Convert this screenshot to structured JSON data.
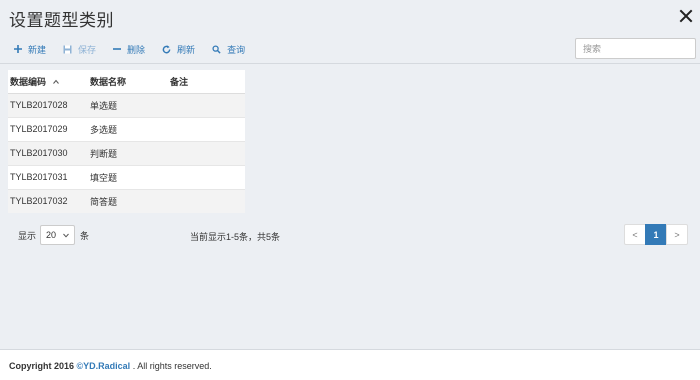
{
  "header": {
    "title": "设置题型类别"
  },
  "toolbar": {
    "new_label": "新建",
    "save_label": "保存",
    "delete_label": "删除",
    "refresh_label": "刷新",
    "query_label": "查询",
    "search_placeholder": "搜索"
  },
  "table": {
    "columns": [
      "数据编码",
      "数据名称",
      "备注"
    ],
    "rows": [
      {
        "code": "TYLB2017028",
        "name": "单选题",
        "remark": ""
      },
      {
        "code": "TYLB2017029",
        "name": "多选题",
        "remark": ""
      },
      {
        "code": "TYLB2017030",
        "name": "判断题",
        "remark": ""
      },
      {
        "code": "TYLB2017031",
        "name": "填空题",
        "remark": ""
      },
      {
        "code": "TYLB2017032",
        "name": "简答题",
        "remark": ""
      }
    ]
  },
  "pager": {
    "show_label": "显示",
    "page_size": "20",
    "unit_label": "条",
    "info": "当前显示1-5条，共5条",
    "prev": "<",
    "current_page": "1",
    "next": ">"
  },
  "footer": {
    "copyright_prefix": "Copyright 2016 ",
    "brand": "©YD.Radical",
    "suffix": " . All rights reserved."
  },
  "colors": {
    "accent": "#337ab7",
    "background": "#eceff3"
  }
}
